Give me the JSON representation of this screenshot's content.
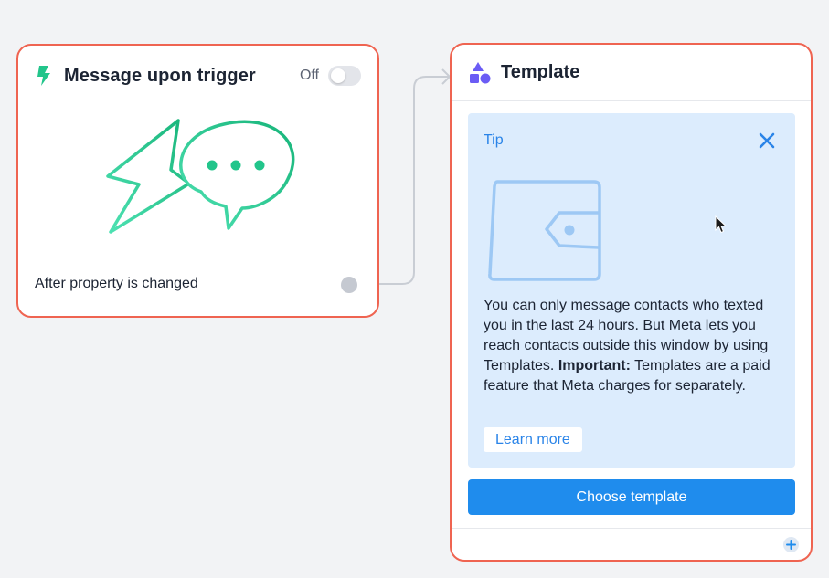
{
  "trigger_node": {
    "title": "Message upon trigger",
    "toggle_state": "Off",
    "condition": "After property is changed",
    "icons": {
      "header": "lightning-bolt-icon",
      "illustration": "bolt-speech-bubble-illustration"
    }
  },
  "template_node": {
    "title": "Template",
    "icon": "shapes-icon",
    "tip": {
      "label": "Tip",
      "text_before_bold": "You can only message contacts who texted you in the last 24 hours. But Meta lets you reach contacts outside this window by using Templates. ",
      "text_bold": "Important:",
      "text_after_bold": " Templates are a paid feature that Meta charges for separately.",
      "learn_more_label": "Learn more",
      "close_icon": "close-icon",
      "illustration": "wallet-icon"
    },
    "choose_button_label": "Choose template",
    "add_icon": "plus-icon"
  },
  "colors": {
    "node_border": "#ef6451",
    "accent_green": "#22c58b",
    "tip_background": "#dcecfd",
    "primary_blue": "#1f8ced",
    "link_blue": "#2a84e8",
    "shapes_purple": "#6b5cf5"
  }
}
